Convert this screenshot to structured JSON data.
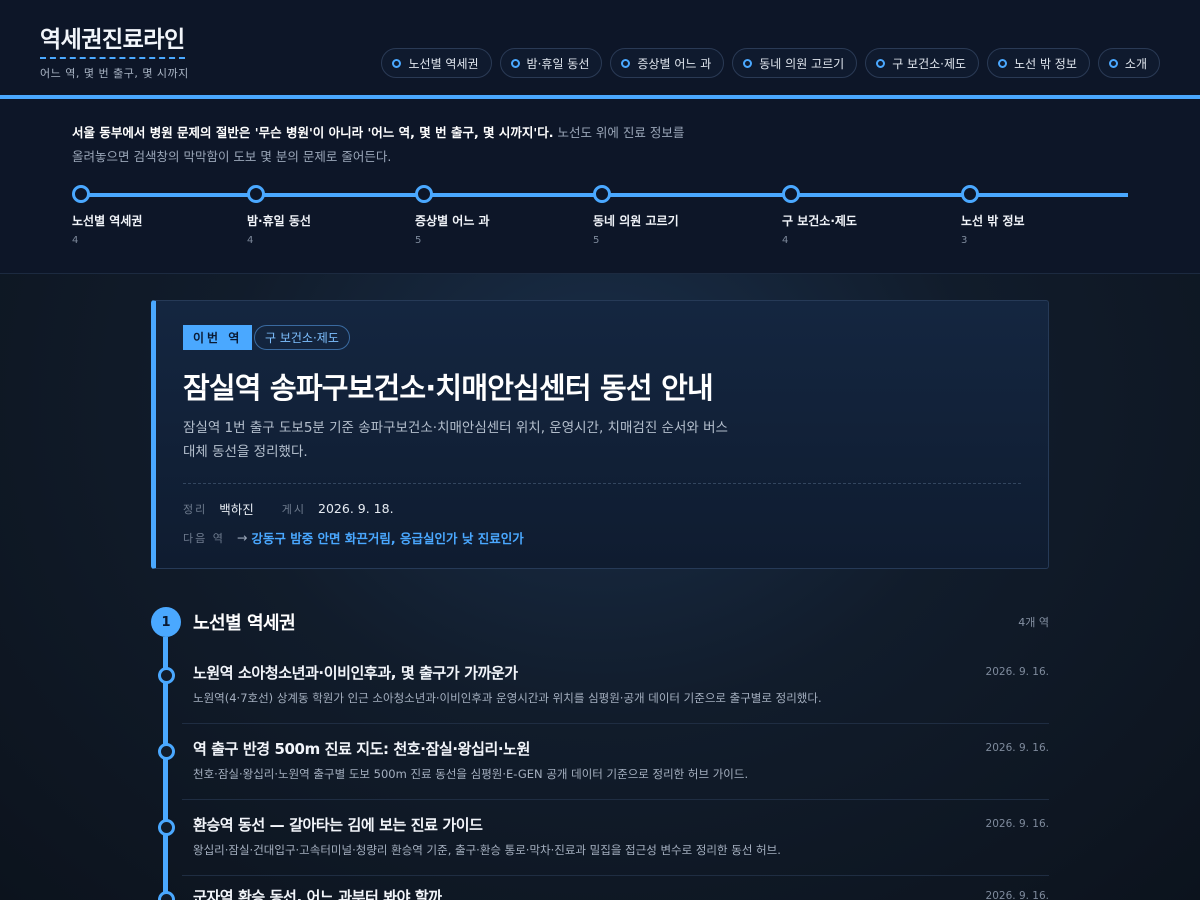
{
  "site": {
    "title": "역세권진료라인",
    "subtitle": "어느 역, 몇 번 출구, 몇 시까지"
  },
  "nav": {
    "items": [
      {
        "label": "노선별 역세권"
      },
      {
        "label": "밤·휴일 동선"
      },
      {
        "label": "증상별 어느 과"
      },
      {
        "label": "동네 의원 고르기"
      },
      {
        "label": "구 보건소·제도"
      },
      {
        "label": "노선 밖 정보"
      },
      {
        "label": "소개"
      }
    ]
  },
  "intro": {
    "lead": "서울 동부에서 병원 문제의 절반은 '무슨 병원'이 아니라 '어느 역, 몇 번 출구, 몇 시까지'다.",
    "rest": " 노선도 위에 진료 정보를 올려놓으면 검색창의 막막함이 도보 몇 분의 문제로 줄어든다."
  },
  "route": {
    "stops": [
      {
        "name": "노선별 역세권",
        "count": "4"
      },
      {
        "name": "밤·휴일 동선",
        "count": "4"
      },
      {
        "name": "증상별 어느 과",
        "count": "5"
      },
      {
        "name": "동네 의원 고르기",
        "count": "5"
      },
      {
        "name": "구 보건소·제도",
        "count": "4"
      },
      {
        "name": "노선 밖 정보",
        "count": "3"
      }
    ]
  },
  "feature": {
    "badge": "이번 역",
    "category": "구 보건소·제도",
    "title": "잠실역 송파구보건소·치매안심센터 동선 안내",
    "description": "잠실역 1번 출구 도보5분 기준 송파구보건소·치매안심센터 위치, 운영시간, 치매검진 순서와 버스 대체 동선을 정리했다.",
    "author_label": "정리",
    "author": "백하진",
    "posted_label": "게시",
    "posted": "2026. 9. 18.",
    "next_label": "다음 역",
    "next_arrow": "→",
    "next_title": "강동구 밤중 안면 화끈거림, 응급실인가 낮 진료인가"
  },
  "section": {
    "number": "1",
    "title": "노선별 역세권",
    "count": "4개 역",
    "items": [
      {
        "title": "노원역 소아청소년과·이비인후과, 몇 출구가 가까운가",
        "date": "2026. 9. 16.",
        "desc": "노원역(4·7호선) 상계동 학원가 인근 소아청소년과·이비인후과 운영시간과 위치를 심평원·공개 데이터 기준으로 출구별로 정리했다."
      },
      {
        "title": "역 출구 반경 500m 진료 지도: 천호·잠실·왕십리·노원",
        "date": "2026. 9. 16.",
        "desc": "천호·잠실·왕십리·노원역 출구별 도보 500m 진료 동선을 심평원·E-GEN 공개 데이터 기준으로 정리한 허브 가이드."
      },
      {
        "title": "환승역 동선 — 갈아타는 김에 보는 진료 가이드",
        "date": "2026. 9. 16.",
        "desc": "왕십리·잠실·건대입구·고속터미널·청량리 환승역 기준, 출구·환승 통로·막차·진료과 밀집을 접근성 변수로 정리한 동선 허브."
      },
      {
        "title": "군자역 환승 동선, 어느 과부터 봐야 할까",
        "date": "2026. 9. 16.",
        "desc": ""
      }
    ]
  },
  "colors": {
    "accent": "#4aa8ff",
    "background": "#0d141f",
    "header": "#0d1628"
  }
}
